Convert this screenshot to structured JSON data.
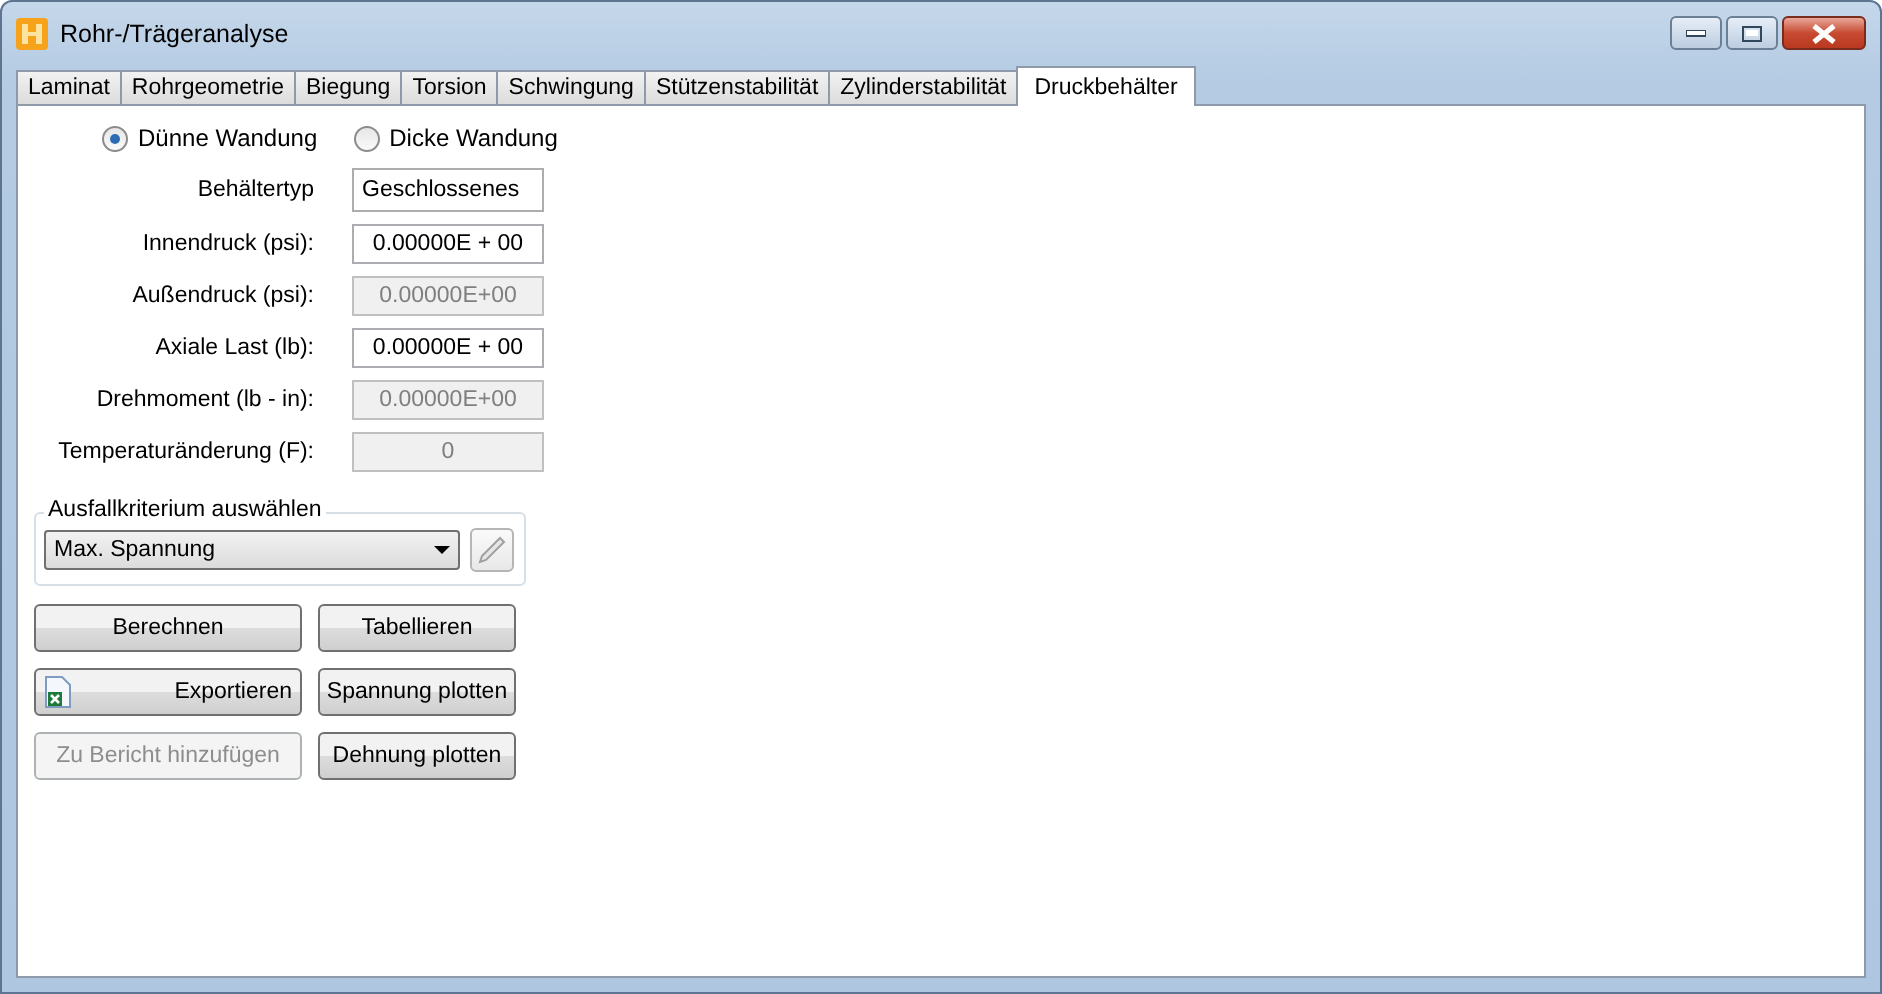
{
  "window": {
    "title": "Rohr-/Trägeranalyse"
  },
  "tabs": [
    {
      "label": "Laminat",
      "selected": false
    },
    {
      "label": "Rohrgeometrie",
      "selected": false
    },
    {
      "label": "Biegung",
      "selected": false
    },
    {
      "label": "Torsion",
      "selected": false
    },
    {
      "label": "Schwingung",
      "selected": false
    },
    {
      "label": "Stützenstabilität",
      "selected": false
    },
    {
      "label": "Zylinderstabilität",
      "selected": false
    },
    {
      "label": "Druckbehälter",
      "selected": true
    }
  ],
  "wall_options": [
    {
      "label": "Dünne Wandung",
      "selected": true
    },
    {
      "label": "Dicke Wandung",
      "selected": false
    }
  ],
  "fields": [
    {
      "kind": "dropdown",
      "label": "Behältertyp",
      "value": "Geschlossenes"
    },
    {
      "kind": "input",
      "label": "Innendruck (psi):",
      "value": "0.00000E + 00",
      "disabled": false
    },
    {
      "kind": "input",
      "label": "Außendruck (psi):",
      "value": "0.00000E+00",
      "disabled": true
    },
    {
      "kind": "input",
      "label": "Axiale Last (lb):",
      "value": "0.00000E + 00",
      "disabled": false
    },
    {
      "kind": "input",
      "label": "Drehmoment (lb - in):",
      "value": "0.00000E+00",
      "disabled": true
    },
    {
      "kind": "input",
      "label": "Temperaturänderung (F):",
      "value": "0",
      "disabled": true
    }
  ],
  "failure_criterion": {
    "title": "Ausfallkriterium auswählen",
    "value": "Max. Spannung"
  },
  "buttons": [
    {
      "label": "Berechnen",
      "disabled": false,
      "kind": "plain"
    },
    {
      "label": "Tabellieren",
      "disabled": false,
      "kind": "plain"
    },
    {
      "label": "Exportieren",
      "disabled": false,
      "kind": "spreadsheet"
    },
    {
      "label": "Spannung plotten",
      "disabled": false,
      "kind": "plain"
    },
    {
      "label": "Zu Bericht hinzufügen",
      "disabled": true,
      "kind": "plain"
    },
    {
      "label": "Dehnung plotten",
      "disabled": false,
      "kind": "plain"
    }
  ]
}
